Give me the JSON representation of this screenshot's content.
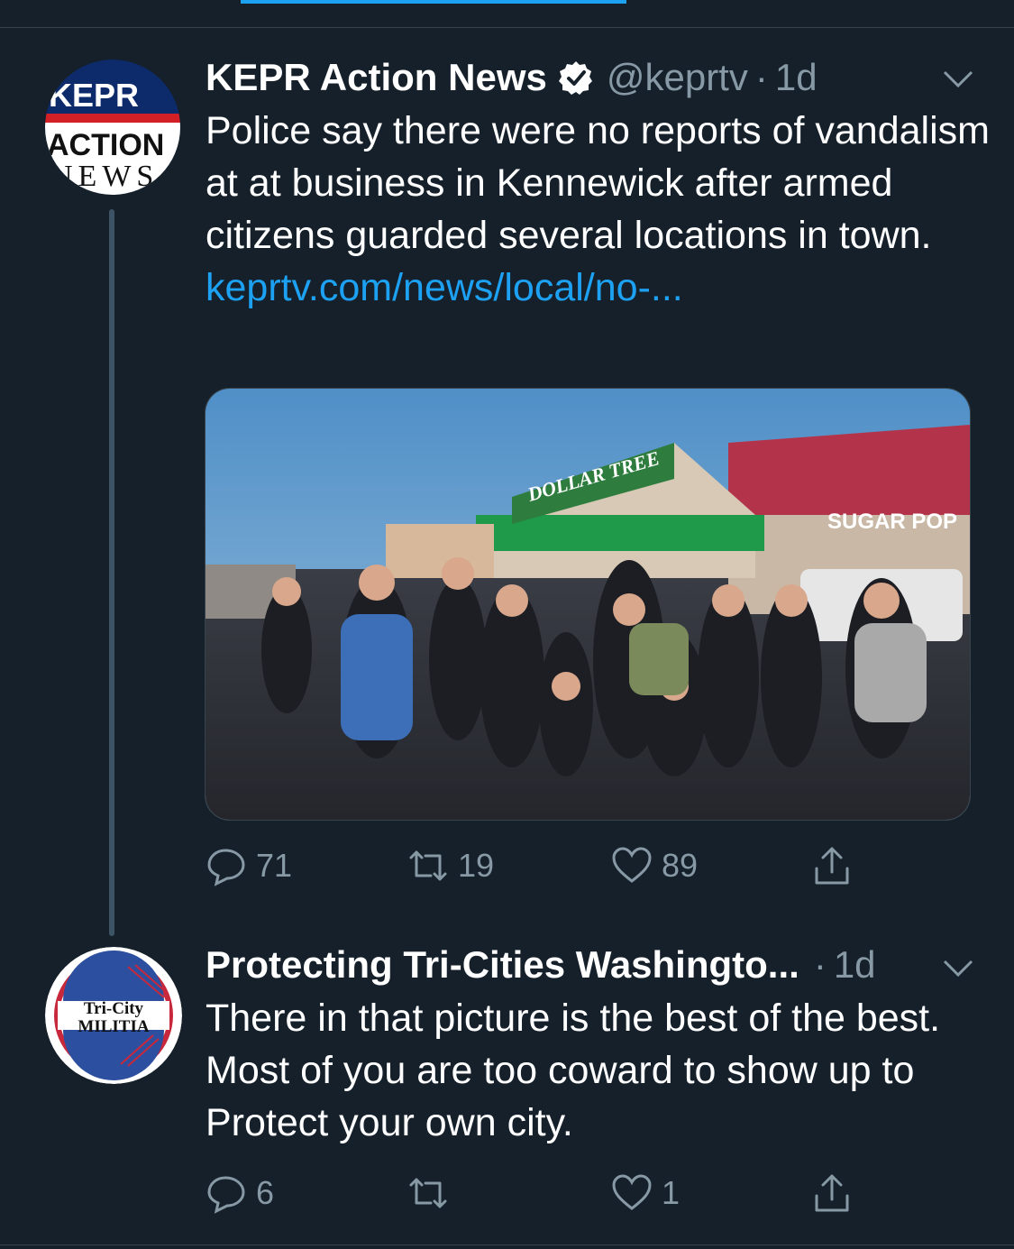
{
  "tweets": [
    {
      "avatar": {
        "line1": "KEPR",
        "line2": "ACTION",
        "line3": "NEWS"
      },
      "name": "KEPR Action News",
      "verified": true,
      "handle": "@keprtv",
      "separator": "·",
      "time": "1d",
      "text": "Police say there were no reports of vandalism at at business in Kennewick after armed citizens guarded several locations in town.",
      "link": "keprtv.com/news/local/no-...",
      "media": {
        "store_sign": "DOLLAR TREE",
        "neighbor_sign": "SUGAR POP"
      },
      "actions": {
        "replies": "71",
        "retweets": "19",
        "likes": "89"
      }
    },
    {
      "avatar": {
        "line1": "Tri-City",
        "line2": "MILITIA"
      },
      "name": "Protecting Tri-Cities Washingto...",
      "handle": "",
      "separator": "·",
      "time": "1d",
      "text": "There in that picture is the best of the best. Most of you are too coward to show up to Protect your own city.",
      "actions": {
        "replies": "6",
        "retweets": "",
        "likes": "1"
      }
    }
  ],
  "colors": {
    "background": "#15202b",
    "accent": "#1da1f2",
    "secondary_text": "#8899a6"
  }
}
